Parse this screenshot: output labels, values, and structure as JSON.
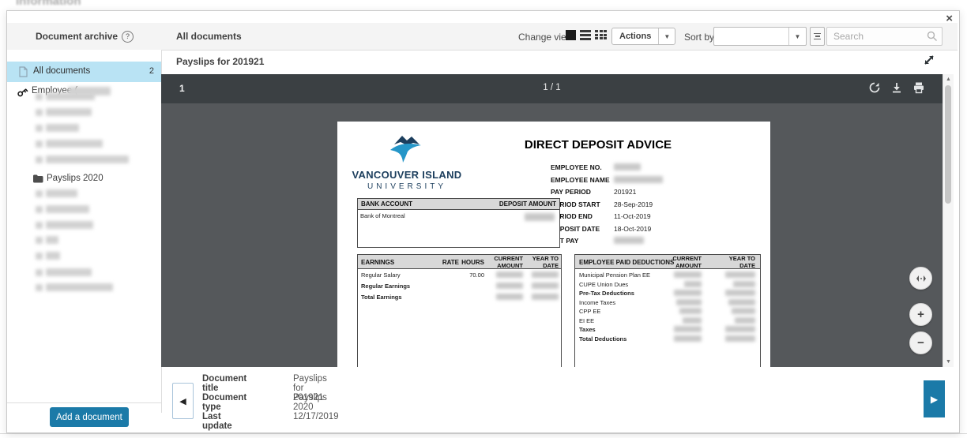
{
  "window": {
    "close": "×",
    "background_text": "information"
  },
  "archive_panel": {
    "title": "Document archive",
    "help": "?",
    "all_documents_label": "All documents",
    "all_documents_count": "2",
    "employee_label": "Employee (",
    "folder_label": "Payslips 2020",
    "add_button_label": "Add a document"
  },
  "topbar": {
    "list_title": "All documents",
    "change_view_label": "Change view",
    "actions_label": "Actions",
    "actions_arrow": "▼",
    "sort_by_label": "Sort by",
    "sort_arrow": "▼",
    "search_placeholder": "Search"
  },
  "viewer": {
    "document_title": "Payslips for 201921",
    "current_page": "1",
    "page_indicator": "1 / 1",
    "zoom_in": "+",
    "zoom_out": "−",
    "prev_arrow": "◀",
    "next_arrow": "▶",
    "scroll_up": "▲",
    "scroll_down": "▼"
  },
  "pdf": {
    "heading": "DIRECT DEPOSIT ADVICE",
    "university_line1": "VANCOUVER ISLAND",
    "university_line2": "UNIVERSITY",
    "info": [
      {
        "label": "EMPLOYEE NO.",
        "value": ""
      },
      {
        "label": "EMPLOYEE NAME",
        "value": ""
      },
      {
        "label": "PAY PERIOD",
        "value": "201921"
      },
      {
        "label": "PERIOD START",
        "value": "28-Sep-2019"
      },
      {
        "label": "PERIOD END",
        "value": "11-Oct-2019"
      },
      {
        "label": "DEPOSIT DATE",
        "value": "18-Oct-2019"
      },
      {
        "label": "NET PAY",
        "value": ""
      }
    ],
    "bank_table": {
      "header_left": "BANK ACCOUNT",
      "header_right": "DEPOSIT AMOUNT",
      "row_bank_name": "Bank of Montreal"
    },
    "earnings_table": {
      "headers": {
        "name": "EARNINGS",
        "rate": "RATE",
        "hours": "HOURS",
        "current_1": "CURRENT",
        "current_2": "AMOUNT",
        "ytd_1": "YEAR TO",
        "ytd_2": "DATE"
      },
      "rows": [
        {
          "name": "Regular Salary",
          "hours": "70.00"
        },
        {
          "name": "Regular Earnings"
        },
        {
          "name": "Total Earnings"
        }
      ]
    },
    "deductions_table": {
      "headers": {
        "name": "EMPLOYEE PAID DEDUCTIONS",
        "current_1": "CURRENT",
        "current_2": "AMOUNT",
        "ytd_1": "YEAR TO",
        "ytd_2": "DATE"
      },
      "rows": [
        {
          "name": "Municipal Pension Plan EE"
        },
        {
          "name": "CUPE Union Dues"
        },
        {
          "name": "Pre-Tax Deductions"
        },
        {
          "name": "Income Taxes"
        },
        {
          "name": "CPP EE"
        },
        {
          "name": "EI EE"
        },
        {
          "name": "Taxes"
        },
        {
          "name": "Total Deductions"
        }
      ]
    }
  },
  "footer": {
    "fields": [
      {
        "label": "Document title",
        "value": "Payslips for 201921"
      },
      {
        "label": "Document type",
        "value": "Payslips 2020"
      },
      {
        "label": "Last update",
        "value": "12/17/2019"
      }
    ]
  },
  "colors": {
    "accent_blue": "#1b7aa8",
    "selection_blue": "#b9e3f4",
    "toolbar_dark": "#3b4043",
    "viewer_gray": "#55585b",
    "logo_navy": "#1c3e5d",
    "logo_blue": "#2596c8"
  }
}
